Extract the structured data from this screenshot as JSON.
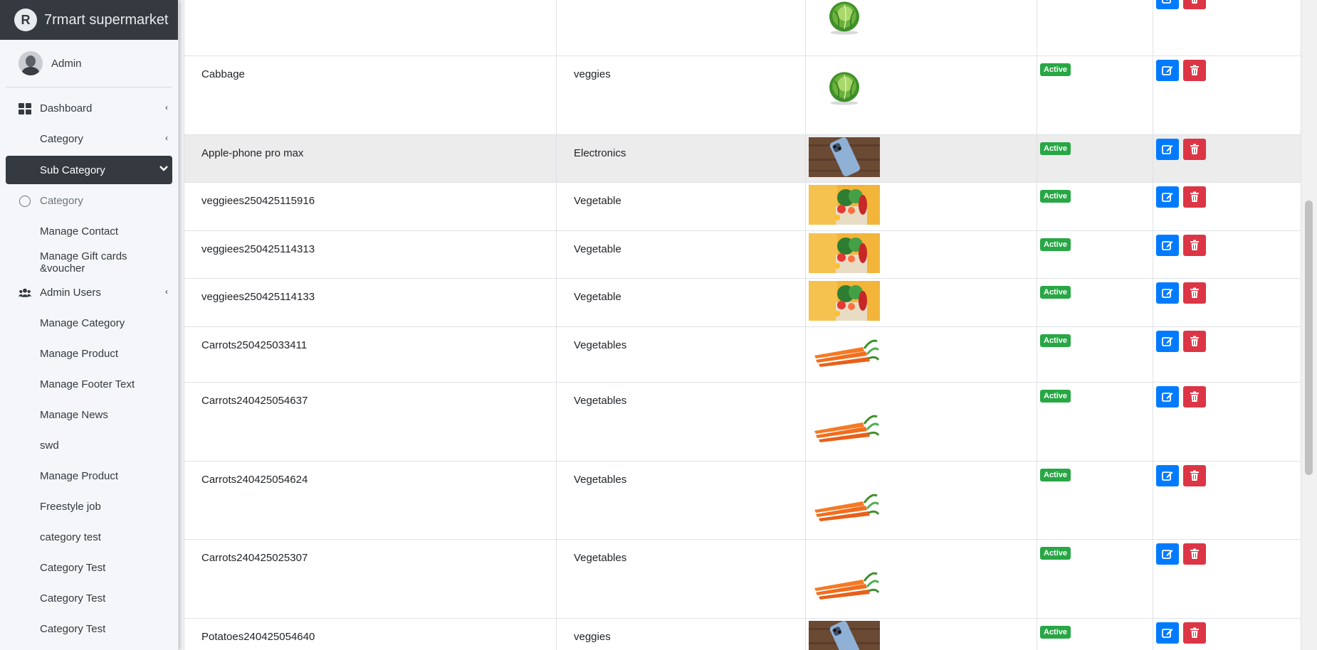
{
  "app": {
    "brand": "7rmart supermarket",
    "logo_letter": "R"
  },
  "user": {
    "name": "Admin"
  },
  "sidebar": {
    "items": [
      {
        "label": "Dashboard"
      },
      {
        "label": "Category"
      },
      {
        "label": "Sub Category"
      },
      {
        "label": "Category"
      },
      {
        "label": "Manage Contact"
      },
      {
        "label": "Manage Gift cards &voucher"
      },
      {
        "label": "Admin Users"
      },
      {
        "label": "Manage Category"
      },
      {
        "label": "Manage Product"
      },
      {
        "label": "Manage Footer Text"
      },
      {
        "label": "Manage News"
      },
      {
        "label": "swd"
      },
      {
        "label": "Manage Product"
      },
      {
        "label": "Freestyle job"
      },
      {
        "label": "category test"
      },
      {
        "label": "Category Test"
      },
      {
        "label": "Category Test"
      },
      {
        "label": "Category Test"
      }
    ]
  },
  "table": {
    "rows": [
      {
        "name": "",
        "category": "",
        "image": "cabbage",
        "status": "Active"
      },
      {
        "name": "Cabbage",
        "category": "veggies",
        "image": "cabbage",
        "status": "Active"
      },
      {
        "name": "Apple-phone pro max",
        "category": "Electronics",
        "image": "phone",
        "status": "Active"
      },
      {
        "name": "veggiees250425115916",
        "category": "Vegetable",
        "image": "veggie-bag",
        "status": "Active"
      },
      {
        "name": "veggiees250425114313",
        "category": "Vegetable",
        "image": "veggie-bag",
        "status": "Active"
      },
      {
        "name": "veggiees250425114133",
        "category": "Vegetable",
        "image": "veggie-bag",
        "status": "Active"
      },
      {
        "name": "Carrots250425033411",
        "category": "Vegetables",
        "image": "carrots",
        "status": "Active"
      },
      {
        "name": "Carrots240425054637",
        "category": "Vegetables",
        "image": "carrots",
        "status": "Active"
      },
      {
        "name": "Carrots240425054624",
        "category": "Vegetables",
        "image": "carrots",
        "status": "Active"
      },
      {
        "name": "Carrots240425025307",
        "category": "Vegetables",
        "image": "carrots",
        "status": "Active"
      },
      {
        "name": "Potatoes240425054640",
        "category": "veggies",
        "image": "phone",
        "status": "Active"
      }
    ]
  },
  "colors": {
    "sidebar_dark": "#343a40",
    "active_badge": "#28a745",
    "edit_button": "#007bff",
    "delete_button": "#dc3545"
  },
  "icons": {
    "edit": "edit-icon",
    "delete": "trash-icon"
  }
}
